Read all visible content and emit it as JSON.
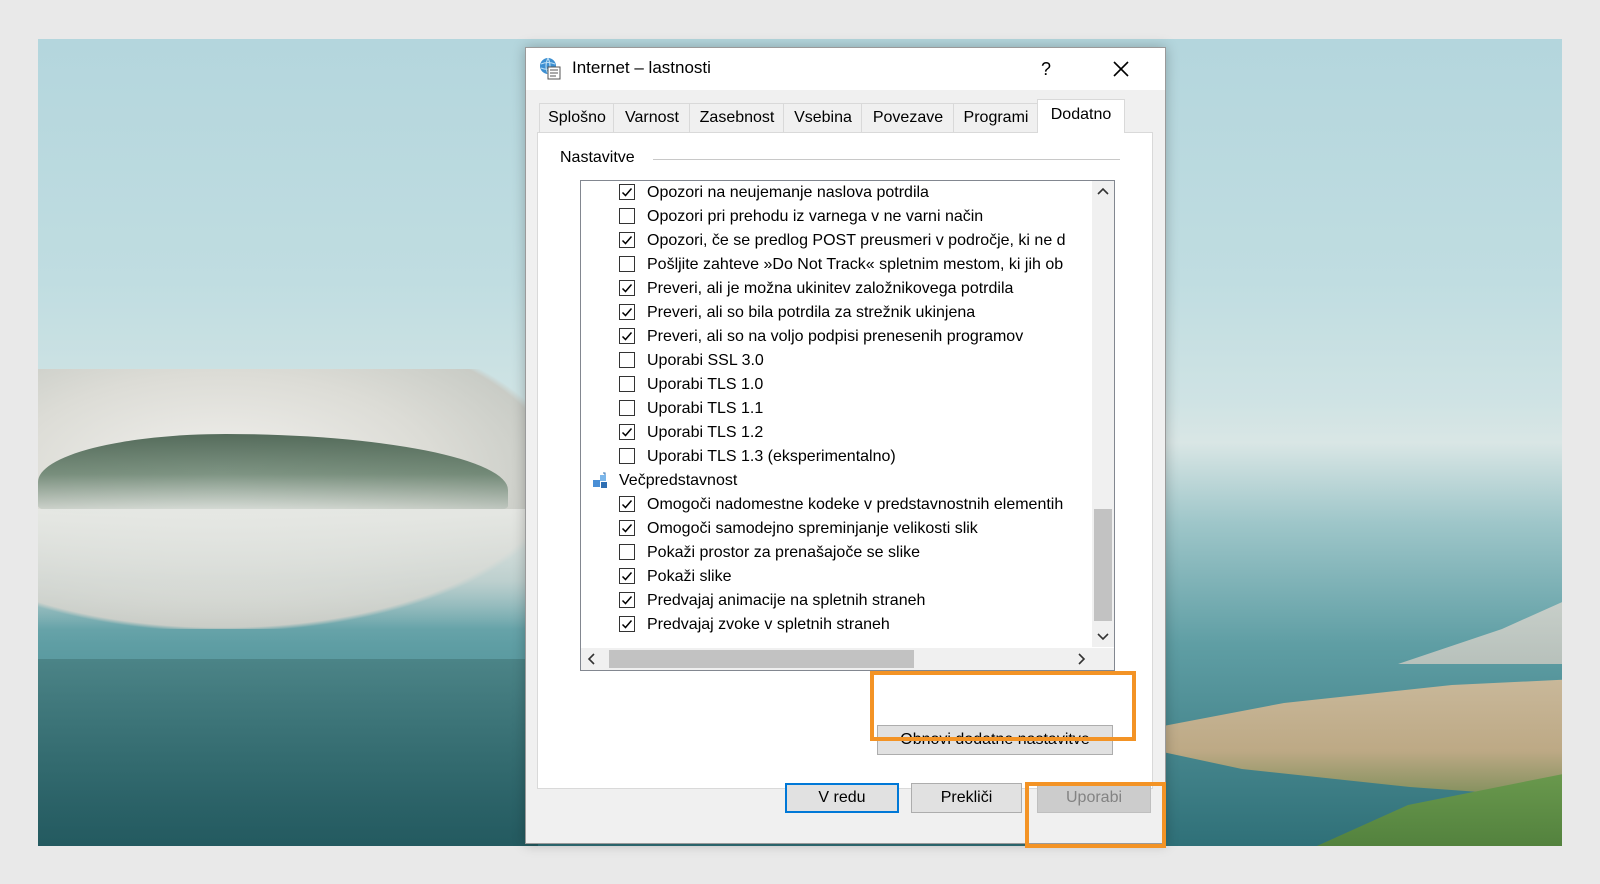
{
  "dialog": {
    "title": "Internet – lastnosti",
    "help_label": "?"
  },
  "tabs": [
    {
      "label": "Splošno"
    },
    {
      "label": "Varnost"
    },
    {
      "label": "Zasebnost"
    },
    {
      "label": "Vsebina"
    },
    {
      "label": "Povezave"
    },
    {
      "label": "Programi"
    },
    {
      "label": "Dodatno",
      "active": true
    }
  ],
  "settings": {
    "group_label": "Nastavitve",
    "items": [
      {
        "label": "Opozori na neujemanje naslova potrdila",
        "checked": true
      },
      {
        "label": "Opozori pri prehodu iz varnega v ne varni način",
        "checked": false
      },
      {
        "label": "Opozori, če se predlog POST preusmeri v področje, ki ne d",
        "checked": true
      },
      {
        "label": "Pošljite zahteve »Do Not Track« spletnim mestom, ki jih ob",
        "checked": false
      },
      {
        "label": "Preveri, ali je možna ukinitev založnikovega potrdila",
        "checked": true
      },
      {
        "label": "Preveri, ali so bila potrdila za strežnik ukinjena",
        "checked": true
      },
      {
        "label": "Preveri, ali so na voljo podpisi prenesenih programov",
        "checked": true
      },
      {
        "label": "Uporabi SSL 3.0",
        "checked": false
      },
      {
        "label": "Uporabi TLS 1.0",
        "checked": false
      },
      {
        "label": "Uporabi TLS 1.1",
        "checked": false
      },
      {
        "label": "Uporabi TLS 1.2",
        "checked": true
      },
      {
        "label": "Uporabi TLS 1.3 (eksperimentalno)",
        "checked": false
      }
    ],
    "category": "Večpredstavnost",
    "category_items": [
      {
        "label": "Omogoči nadomestne kodeke v predstavnostnih elementih",
        "checked": true
      },
      {
        "label": "Omogoči samodejno spreminjanje velikosti slik",
        "checked": true
      },
      {
        "label": "Pokaži prostor za prenašajoče se slike",
        "checked": false
      },
      {
        "label": "Pokaži slike",
        "checked": true
      },
      {
        "label": "Predvajaj animacije na spletnih straneh",
        "checked": true
      },
      {
        "label": "Predvajaj zvoke v spletnih straneh",
        "checked": true
      }
    ],
    "vertical_scroll_fraction": 1.0
  },
  "buttons": {
    "reset_label": "Obnovi dodatne nastavitve",
    "ok_label": "V redu",
    "cancel_label": "Prekliči",
    "apply_label": "Uporabi"
  },
  "colors": {
    "highlight": "#f39325",
    "focus": "#0078d7"
  },
  "icons": [
    "internet-options-icon",
    "close-icon",
    "multimedia-category-icon",
    "checkmark-icon",
    "scroll-up-icon",
    "scroll-down-icon",
    "scroll-left-icon",
    "scroll-right-icon"
  ]
}
